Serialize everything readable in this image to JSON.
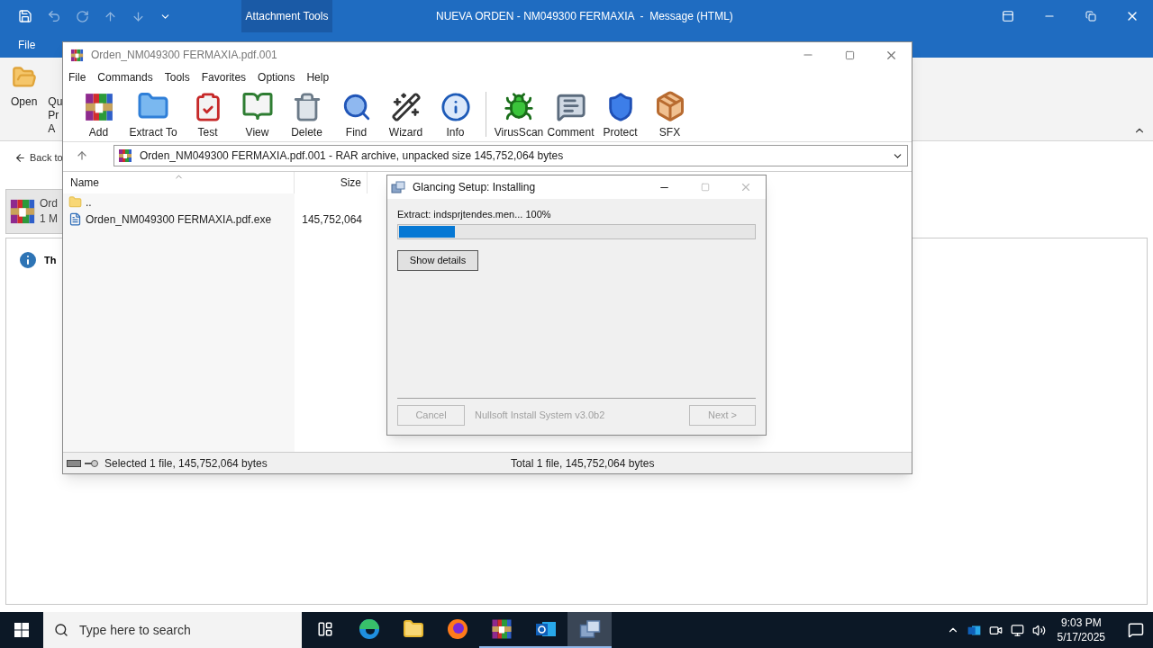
{
  "outlook": {
    "contextual_tab": "Attachment Tools",
    "title": "NUEVA ORDEN - NM049300 FERMAXIA  -  Message (HTML)",
    "file_tab": "File",
    "open_label": "Open",
    "partial_labels": [
      "Qu",
      "Pr",
      "A"
    ],
    "back_link": "Back to",
    "attachment": {
      "name": "Ord",
      "size": "1 M"
    },
    "info_text": "Th"
  },
  "winrar": {
    "title": "Orden_NM049300 FERMAXIA.pdf.001",
    "menu": [
      "File",
      "Commands",
      "Tools",
      "Favorites",
      "Options",
      "Help"
    ],
    "toolbar": [
      "Add",
      "Extract To",
      "Test",
      "View",
      "Delete",
      "Find",
      "Wizard",
      "Info",
      "VirusScan",
      "Comment",
      "Protect",
      "SFX"
    ],
    "address": "Orden_NM049300 FERMAXIA.pdf.001 - RAR archive, unpacked size 145,752,064 bytes",
    "columns": [
      "Name",
      "Size"
    ],
    "rows": [
      {
        "kind": "folder",
        "name": ".."
      },
      {
        "kind": "file",
        "name": "Orden_NM049300 FERMAXIA.pdf.exe",
        "size": "145,752,064"
      }
    ],
    "status": [
      "Selected 1 file, 145,752,064 bytes",
      "Total 1 file, 145,752,064 bytes"
    ]
  },
  "installer": {
    "title": "Glancing Setup: Installing",
    "status": "Extract: indsprjtendes.men... 100%",
    "level": 0.157,
    "details_button": "Show details",
    "cancel": {
      "label": "Cancel",
      "disabled": true
    },
    "branding": "Nullsoft Install System v3.0b2",
    "next": {
      "label": "Next >",
      "disabled": true
    }
  },
  "taskbar": {
    "search_placeholder": "Type here to search",
    "apps": [
      {
        "running": false,
        "selected": false
      },
      {
        "running": false,
        "selected": false
      },
      {
        "running": false,
        "selected": false
      },
      {
        "running": false,
        "selected": false
      },
      {
        "running": true,
        "selected": false
      },
      {
        "running": true,
        "selected": false
      },
      {
        "running": true,
        "selected": true
      }
    ],
    "time": "9:03 PM",
    "date": "5/17/2025"
  }
}
